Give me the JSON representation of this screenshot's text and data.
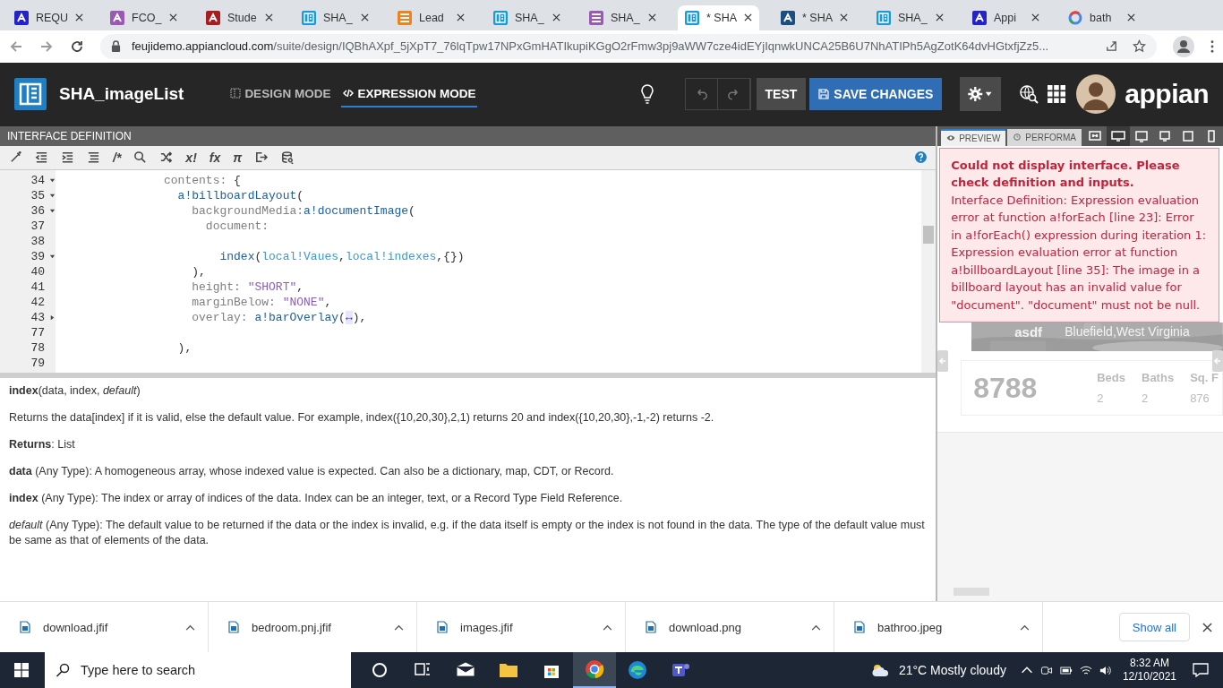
{
  "browser": {
    "tabs": [
      {
        "label": "REQU",
        "kind": "appian",
        "selected": false
      },
      {
        "label": "FCO_",
        "kind": "flow",
        "selected": false
      },
      {
        "label": "Stude",
        "kind": "student",
        "selected": false
      },
      {
        "label": "SHA_",
        "kind": "interface",
        "selected": false
      },
      {
        "label": "Lead",
        "kind": "lead",
        "selected": false
      },
      {
        "label": "SHA_",
        "kind": "interface",
        "selected": false
      },
      {
        "label": "SHA_",
        "kind": "record",
        "selected": false
      },
      {
        "label": "* SHA",
        "kind": "interface",
        "selected": true
      },
      {
        "label": "* SHA",
        "kind": "process",
        "selected": false
      },
      {
        "label": "SHA_",
        "kind": "interface",
        "selected": false
      },
      {
        "label": "Appi",
        "kind": "appian",
        "selected": false
      },
      {
        "label": "bath",
        "kind": "google",
        "selected": false
      }
    ],
    "address": {
      "host": "feujidemo.appiancloud.com",
      "path": "/suite/design/IQBhAXpf_5jXpT7_76lqTpw17NPxGmHATIkupiKGgO2rFmw3pj9aWW7cze4idEYjIqnwkUNCA25B6U7NhATIPh5AgZotK64dvHGtxfjZz5..."
    }
  },
  "header": {
    "title": "SHA_imageList",
    "modes": [
      {
        "label": "DESIGN MODE",
        "kind": "design",
        "selected": false
      },
      {
        "label": "EXPRESSION MODE",
        "kind": "code",
        "selected": true
      }
    ],
    "buttons": [
      {
        "label": "TEST",
        "kind": "plain"
      },
      {
        "label": "SAVE CHANGES",
        "kind": "primary"
      }
    ],
    "logo": "appian"
  },
  "editor": {
    "title": "INTERFACE DEFINITION",
    "toolbar": [
      {
        "kind": "wand"
      },
      {
        "kind": "outdent"
      },
      {
        "kind": "indent"
      },
      {
        "kind": "list"
      },
      {
        "kind": "glyph",
        "glyph": "/*"
      },
      {
        "kind": "search"
      },
      {
        "kind": "shuffle"
      },
      {
        "kind": "glyph",
        "glyph": "x!"
      },
      {
        "kind": "glyph",
        "glyph": "fx"
      },
      {
        "kind": "glyph",
        "glyph": "π"
      },
      {
        "kind": "export"
      },
      {
        "kind": "database"
      }
    ],
    "lines": [
      {
        "num": "34",
        "kind": "fold",
        "expanded": true,
        "tokens": [
          {
            "kind": "key",
            "text": "               contents:"
          },
          {
            "kind": "plain",
            "text": " {"
          }
        ]
      },
      {
        "num": "35",
        "kind": "fold",
        "expanded": true,
        "tokens": [
          {
            "kind": "fn",
            "text": "                 a!billboardLayout"
          },
          {
            "kind": "plain",
            "text": "("
          }
        ]
      },
      {
        "num": "36",
        "kind": "fold",
        "expanded": true,
        "tokens": [
          {
            "kind": "key",
            "text": "                   backgroundMedia:"
          },
          {
            "kind": "fn",
            "text": "a!documentImage"
          },
          {
            "kind": "plain",
            "text": "("
          }
        ]
      },
      {
        "num": "37",
        "kind": "plain",
        "tokens": [
          {
            "kind": "key",
            "text": "                     document:"
          }
        ]
      },
      {
        "num": "38",
        "kind": "plain"
      },
      {
        "num": "39",
        "kind": "fold",
        "expanded": true,
        "tokens": [
          {
            "kind": "fn",
            "text": "                       index"
          },
          {
            "kind": "plain",
            "text": "("
          },
          {
            "kind": "local",
            "text": "local!Vaues"
          },
          {
            "kind": "plain",
            "text": ","
          },
          {
            "kind": "local",
            "text": "local!indexes"
          },
          {
            "kind": "plain",
            "text": ",{})"
          }
        ]
      },
      {
        "num": "40",
        "kind": "plain",
        "tokens": [
          {
            "kind": "plain",
            "text": "                   ),"
          }
        ]
      },
      {
        "num": "41",
        "kind": "plain",
        "tokens": [
          {
            "kind": "key",
            "text": "                   height: "
          },
          {
            "kind": "str",
            "text": "\"SHORT\""
          },
          {
            "kind": "plain",
            "text": ","
          }
        ]
      },
      {
        "num": "42",
        "kind": "plain",
        "tokens": [
          {
            "kind": "key",
            "text": "                   marginBelow: "
          },
          {
            "kind": "str",
            "text": "\"NONE\""
          },
          {
            "kind": "plain",
            "text": ","
          }
        ]
      },
      {
        "num": "43",
        "kind": "fold",
        "expanded": false,
        "tokens": [
          {
            "kind": "key",
            "text": "                   overlay: "
          },
          {
            "kind": "fn",
            "text": "a!barOverlay"
          },
          {
            "kind": "plain",
            "text": "("
          },
          {
            "kind": "collapsed",
            "text": "↔"
          },
          {
            "kind": "plain",
            "text": "),"
          }
        ]
      },
      {
        "num": "77",
        "kind": "plain"
      },
      {
        "num": "78",
        "kind": "plain",
        "tokens": [
          {
            "kind": "plain",
            "text": "                 ),"
          }
        ]
      },
      {
        "num": "79",
        "kind": "plain"
      }
    ]
  },
  "help": {
    "paragraphs": [
      "**index**(data, index, *default*)",
      "Returns the data[index] if it is valid, else the default value. For example, index({10,20,30},2,1) returns 20 and index({10,20,30},-1,-2) returns -2.",
      "**Returns**: List",
      "**data** (Any Type): A homogeneous array, whose indexed value is expected. Can also be a dictionary, map, CDT, or Record.",
      "**index** (Any Type): The index or array of indices of the data. Index can be an integer, text, or a Record Type Field Reference.",
      "*default* (Any Type): The default value to be returned if the data or the index is invalid, e.g. if the data itself is empty or the index is not found in the data. The type of the default value must be same as that of elements of the data."
    ]
  },
  "preview": {
    "tabs": [
      {
        "label": "PREVIEW",
        "kind": "eye",
        "selected": true
      },
      {
        "label": "PERFORMA",
        "kind": "clock",
        "selected": false
      }
    ],
    "devices": [
      {
        "kind": "fit",
        "selected": false
      },
      {
        "kind": "wide",
        "selected": true
      },
      {
        "kind": "desktop",
        "selected": false
      },
      {
        "kind": "monitor",
        "selected": false
      },
      {
        "kind": "tablet",
        "selected": false
      },
      {
        "kind": "phone",
        "selected": false
      }
    ],
    "error": {
      "title": "Could not display interface. Please check definition and inputs.",
      "message": "Interface Definition: Expression evaluation error at function a!forEach [line 23]: Error in a!forEach() expression during iteration 1: Expression evaluation error at function a!billboardLayout [line 35]: The image in a billboard layout has an invalid value for \"document\". \"document\" must not be null."
    },
    "card": {
      "name": "asdf",
      "location": "Bluefield,West Virginia",
      "price": "8788",
      "stats": [
        {
          "label": "Beds",
          "value": "2"
        },
        {
          "label": "Baths",
          "value": "2"
        },
        {
          "label": "Sq. F",
          "value": "876"
        }
      ]
    }
  },
  "downloads": {
    "files": [
      "download.jfif",
      "bedroom.pnj.jfif",
      "images.jfif",
      "download.png",
      "bathroo.jpeg"
    ],
    "show_all": "Show all"
  },
  "taskbar": {
    "search": {
      "placeholder": "Type here to search"
    },
    "apps": [
      {
        "kind": "cortana",
        "selected": false
      },
      {
        "kind": "taskview",
        "selected": false
      },
      {
        "kind": "mail",
        "selected": false
      },
      {
        "kind": "folder",
        "selected": false
      },
      {
        "kind": "store",
        "selected": false
      },
      {
        "kind": "chrome",
        "selected": true
      },
      {
        "kind": "edge",
        "selected": false
      },
      {
        "kind": "teams",
        "selected": false
      }
    ],
    "weather": "21°C Mostly cloudy",
    "time": "8:32 AM",
    "date": "12/10/2021"
  }
}
